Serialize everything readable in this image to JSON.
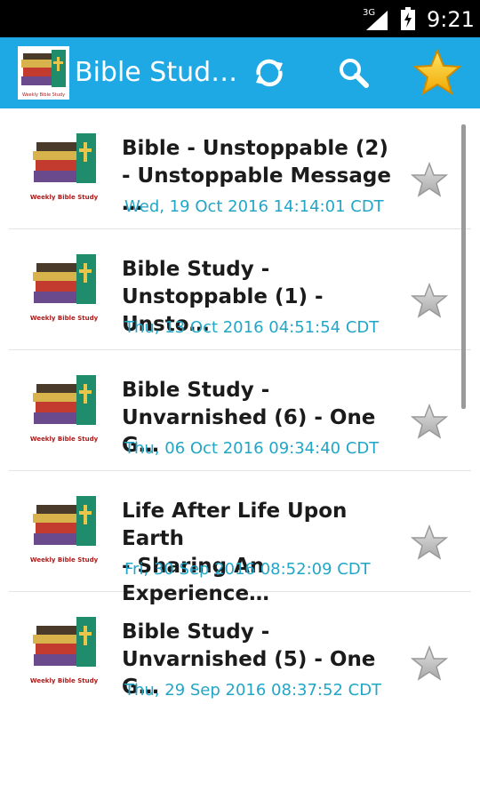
{
  "status_bar": {
    "network": "3G",
    "time": "9:21"
  },
  "app_bar": {
    "title": "Bible Stud…",
    "logo_caption": "Weekly Bible Study",
    "actions": [
      {
        "name": "refresh",
        "icon": "refresh-icon"
      },
      {
        "name": "search",
        "icon": "search-icon"
      },
      {
        "name": "favorites",
        "icon": "star-icon"
      }
    ]
  },
  "colors": {
    "app_bar": "#1fa9e4",
    "date_text": "#22a6c6",
    "title_text": "#1b1b1b",
    "favorite_star": "#f7c21a"
  },
  "thumbnail_caption": "Weekly Bible Study",
  "items": [
    {
      "title": "Bible - Unstoppable (2)\n- Unstoppable Message …",
      "date": "Wed, 19 Oct 2016 14:14:01 CDT"
    },
    {
      "title": "Bible Study -\nUnstoppable (1) - Unsto…",
      "date": "Thu, 13 Oct 2016 04:51:54 CDT"
    },
    {
      "title": "Bible Study -\nUnvarnished (6) - One G…",
      "date": "Thu, 06 Oct 2016 09:34:40 CDT"
    },
    {
      "title": "Life After Life Upon Earth\n- Sharing An Experience…",
      "date": "Fri, 30 Sep 2016 08:52:09 CDT"
    },
    {
      "title": "Bible Study -\nUnvarnished (5) - One G…",
      "date": "Thu, 29 Sep 2016 08:37:52 CDT"
    }
  ]
}
